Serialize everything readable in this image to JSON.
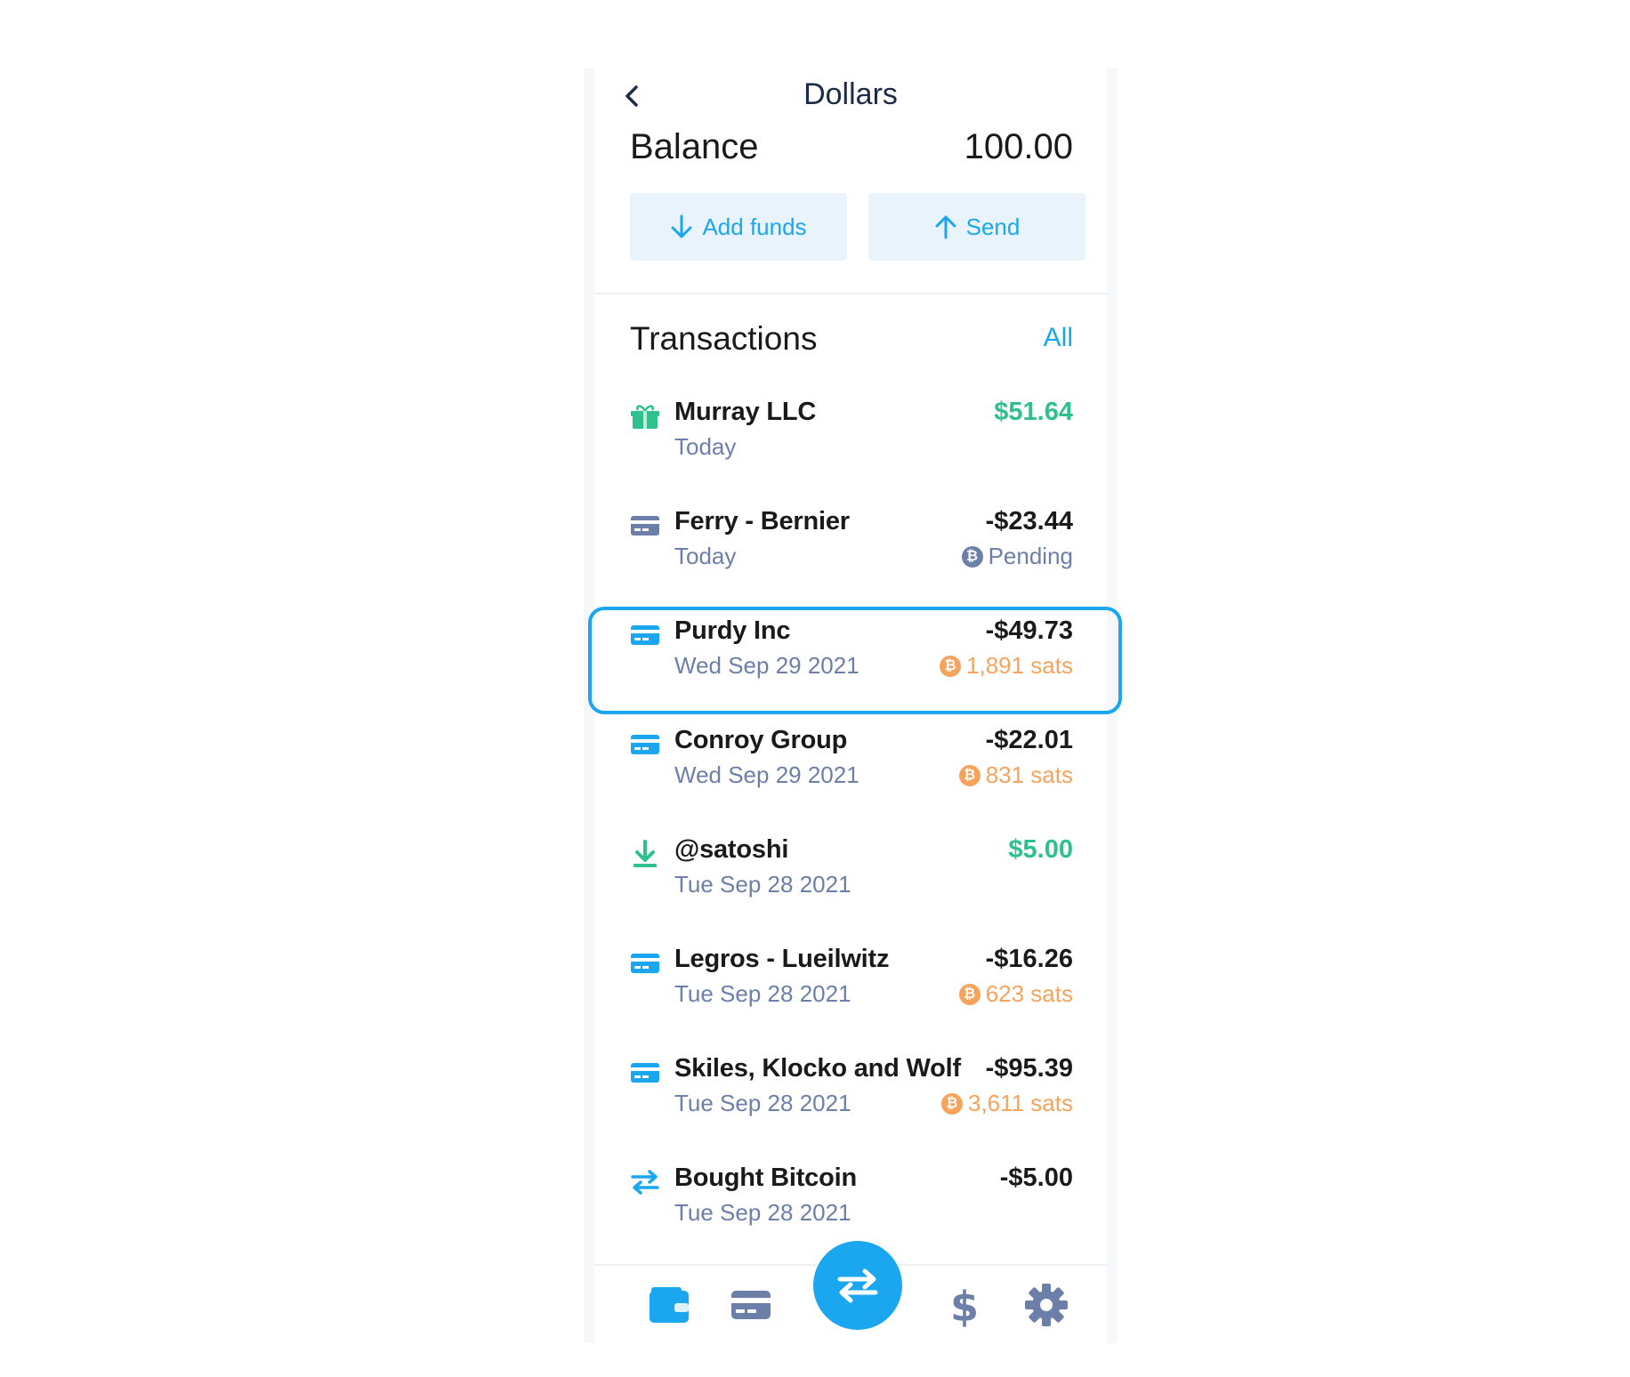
{
  "header": {
    "title": "Dollars"
  },
  "balance": {
    "label": "Balance",
    "value": "100.00"
  },
  "actions": {
    "add_funds": "Add funds",
    "send": "Send"
  },
  "transactions": {
    "title": "Transactions",
    "all_label": "All",
    "items": [
      {
        "icon": "gift-icon",
        "name": "Murray LLC",
        "date": "Today",
        "amount": "$51.64",
        "positive": true
      },
      {
        "icon": "card-icon",
        "name": "Ferry - Bernier",
        "date": "Today",
        "amount": "-$23.44",
        "sub": "Pending",
        "sub_type": "pending"
      },
      {
        "icon": "card-icon",
        "name": "Purdy Inc",
        "date": "Wed Sep 29 2021",
        "amount": "-$49.73",
        "sub": "1,891 sats",
        "sub_type": "sats"
      },
      {
        "icon": "card-icon",
        "name": "Conroy Group",
        "date": "Wed Sep 29 2021",
        "amount": "-$22.01",
        "sub": "831 sats",
        "sub_type": "sats"
      },
      {
        "icon": "download-icon",
        "name": "@satoshi",
        "date": "Tue Sep 28 2021",
        "amount": "$5.00",
        "positive": true
      },
      {
        "icon": "card-icon",
        "name": "Legros - Lueilwitz",
        "date": "Tue Sep 28 2021",
        "amount": "-$16.26",
        "sub": "623 sats",
        "sub_type": "sats"
      },
      {
        "icon": "card-icon",
        "name": "Skiles, Klocko and Wolf",
        "date": "Tue Sep 28 2021",
        "amount": "-$95.39",
        "sub": "3,611 sats",
        "sub_type": "sats"
      },
      {
        "icon": "swap-icon",
        "name": "Bought Bitcoin",
        "date": "Tue Sep 28 2021",
        "amount": "-$5.00"
      }
    ]
  },
  "nav": {
    "items": [
      "wallet-icon",
      "card-icon",
      "swap-icon",
      "dollar-icon",
      "gear-icon"
    ]
  },
  "colors": {
    "accent": "#1aa7f0",
    "positive": "#2ec08d",
    "sats": "#f7a35c",
    "muted": "#6c7fa8"
  }
}
